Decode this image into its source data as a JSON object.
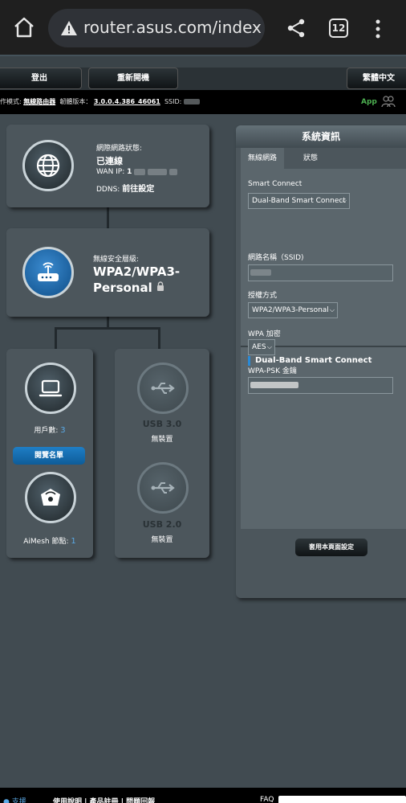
{
  "browser": {
    "url": "router.asus.com/index",
    "tab_count": "12"
  },
  "router_header": {
    "logout_label": "登出",
    "reboot_label": "重新開機",
    "language_label": "繁體中文"
  },
  "status_bar": {
    "mode_label": "作模式:",
    "mode_value": "無線路由器",
    "firmware_label": "韌體版本：",
    "firmware_value": "3.0.0.4.386_46061",
    "ssid_label": "SSID:",
    "app_label": "App"
  },
  "internet": {
    "status_label": "網際網路狀態:",
    "status_value": "已連線",
    "wan_ip_label": "WAN IP:",
    "wan_ip_value": "1",
    "ddns_label": "DDNS:",
    "ddns_link": "前往設定"
  },
  "security": {
    "level_label": "無線安全層級:",
    "level_line1": "WPA2/WPA3-",
    "level_line2": "Personal"
  },
  "clients": {
    "count_label": "用戶數:",
    "count_value": "3",
    "list_button": "閱覽名單"
  },
  "aimesh": {
    "label": "AiMesh 節點:",
    "value": "1"
  },
  "usb": {
    "usb3_label": "USB 3.0",
    "usb3_status": "無裝置",
    "usb2_label": "USB 2.0",
    "usb2_status": "無裝置"
  },
  "system_info": {
    "title": "系統資訊",
    "tab_wireless": "無線網路",
    "tab_status": "狀態",
    "smart_connect_label": "Smart Connect",
    "smart_connect_value": "Dual-Band Smart Connect",
    "section_title": "Dual-Band Smart Connect",
    "ssid_label": "網路名稱（SSID)",
    "auth_label": "授權方式",
    "auth_value": "WPA2/WPA3-Personal",
    "encryption_label": "WPA 加密",
    "encryption_value": "AES",
    "psk_label": "WPA-PSK 金鑰",
    "apply_button": "套用本頁面設定"
  },
  "footer": {
    "left": "● 支援",
    "middle": "使用說明 | 產品註冊 | 問題回報",
    "right": "FAQ"
  },
  "colors": {
    "accent_blue": "#2a8ad6",
    "app_green": "#4caf50",
    "panel_bg": "#4c565c",
    "page_bg": "#414b51"
  }
}
